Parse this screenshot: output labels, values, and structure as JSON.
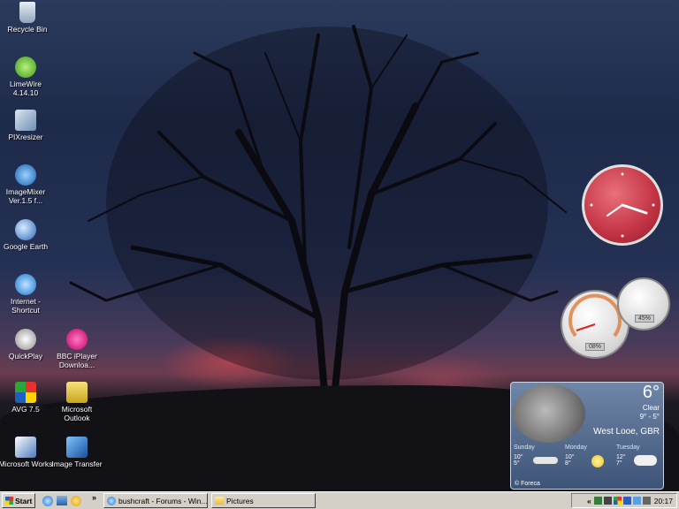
{
  "desktop_icons": [
    {
      "label": "Recycle Bin",
      "icon": "recycle-bin-icon"
    },
    {
      "label": "LimeWire 4.14.10",
      "icon": "limewire-icon"
    },
    {
      "label": "PIXresizer",
      "icon": "pixresizer-icon"
    },
    {
      "label": "ImageMixer Ver.1.5 f...",
      "icon": "imagemixer-icon"
    },
    {
      "label": "Google Earth",
      "icon": "google-earth-icon"
    },
    {
      "label": "Internet - Shortcut",
      "icon": "internet-explorer-icon"
    },
    {
      "label": "QuickPlay",
      "icon": "quickplay-icon"
    },
    {
      "label": "BBC iPlayer Downloa...",
      "icon": "bbc-iplayer-icon"
    },
    {
      "label": "AVG 7.5",
      "icon": "avg-icon"
    },
    {
      "label": "Microsoft Outlook",
      "icon": "outlook-icon"
    },
    {
      "label": "Microsoft Works",
      "icon": "works-icon"
    },
    {
      "label": "Image Transfer",
      "icon": "image-transfer-icon"
    }
  ],
  "gadgets": {
    "cpu_meter": {
      "cpu": "08%",
      "memory": "45%"
    },
    "weather": {
      "temp": "6°",
      "condition": "Clear",
      "hi_lo": "9° - 5°",
      "location": "West Looe, GBR",
      "forecast": [
        {
          "day": "Sunday",
          "hi": "10°",
          "lo": "5°",
          "icon": "cloudy-icon"
        },
        {
          "day": "Monday",
          "hi": "10°",
          "lo": "8°",
          "icon": "sun-icon"
        },
        {
          "day": "Tuesday",
          "hi": "12°",
          "lo": "7°",
          "icon": "cloudy-icon"
        }
      ],
      "credit": "© Foreca"
    }
  },
  "taskbar": {
    "start_label": "Start",
    "overflow": "»",
    "tasks": [
      {
        "label": "bushcraft - Forums - Win...",
        "icon": "ie-icon"
      },
      {
        "label": "Pictures",
        "icon": "folder-icon"
      }
    ],
    "tray_expand": "«",
    "clock": "20:17"
  }
}
